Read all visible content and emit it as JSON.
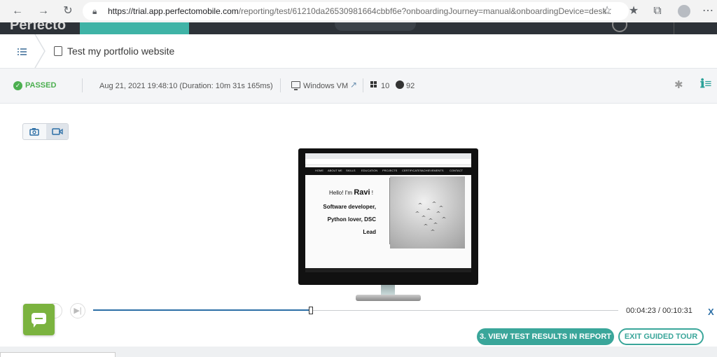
{
  "browser": {
    "url_host": "https://trial.app.perfectomobile.com",
    "url_path": "/reporting/test/61210da26530981664cbbf6e?onboardingJourney=manual&onboardingDevice=desk..."
  },
  "app": {
    "logo_text": "Perfecto"
  },
  "page": {
    "title": "Test my portfolio website"
  },
  "status_bar": {
    "status": "PASSED",
    "run_time": "Aug 21, 2021 19:48:10 (Duration: 10m 31s 165ms)",
    "device": "Windows VM",
    "os_version": "10",
    "browser_version": "92"
  },
  "recording": {
    "site_nav": [
      "HOME",
      "ABOUT ME",
      "SKILLS",
      "EDUCATION",
      "PROJECTS",
      "CERTIFICATES",
      "ACHIEVEMENTS",
      "CONTACT"
    ],
    "hello_prefix": "Hello! I'm ",
    "hello_name": "Ravi",
    "hello_suffix": " !",
    "intro_line_1": "Software developer,",
    "intro_line_2": "Python lover, DSC",
    "intro_line_3": "Lead"
  },
  "player": {
    "progress": 0.415,
    "timecode": "00:04:23 / 00:10:31",
    "close_label": "X"
  },
  "tour": {
    "report_button": "3. VIEW TEST RESULTS IN REPORT",
    "exit_button": "EXIT GUIDED TOUR"
  },
  "colors": {
    "accent_teal": "#3aa69a",
    "passed_green": "#4caf50",
    "link_blue": "#2c6fa6",
    "chat_green": "#7bb33f"
  }
}
